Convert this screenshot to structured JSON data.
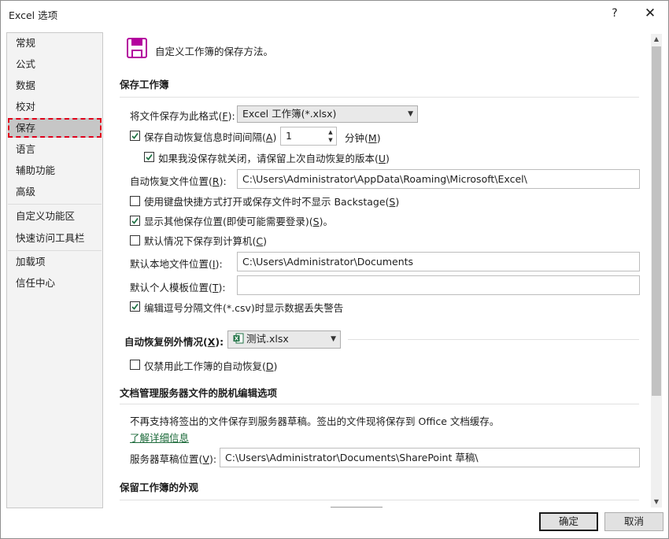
{
  "window": {
    "title": "Excel 选项",
    "help_label": "?",
    "close_label": "✕"
  },
  "nav": {
    "items": [
      "常规",
      "公式",
      "数据",
      "校对",
      "保存",
      "语言",
      "辅助功能",
      "高级",
      "自定义功能区",
      "快速访问工具栏",
      "加载项",
      "信任中心"
    ],
    "selected": "保存"
  },
  "header": {
    "icon": "save-floppy-icon",
    "text": "自定义工作簿的保存方法。"
  },
  "save_workbooks": {
    "title": "保存工作簿",
    "format_label_pre": "将文件保存为此格式(",
    "format_label_key": "F",
    "format_label_post": "):",
    "format_value": "Excel 工作簿(*.xlsx)",
    "autorecover_label_pre": "保存自动恢复信息时间间隔(",
    "autorecover_label_key": "A",
    "autorecover_label_post": ")",
    "autorecover_checked": true,
    "autorecover_minutes": "1",
    "minutes_label_pre": "分钟(",
    "minutes_label_key": "M",
    "minutes_label_post": ")",
    "keep_last_label_pre": "如果我没保存就关闭，请保留上次自动恢复的版本(",
    "keep_last_label_key": "U",
    "keep_last_label_post": ")",
    "keep_last_checked": true,
    "recover_location_label_pre": "自动恢复文件位置(",
    "recover_location_label_key": "R",
    "recover_location_label_post": "):",
    "recover_location_value": "C:\\Users\\Administrator\\AppData\\Roaming\\Microsoft\\Excel\\",
    "no_backstage_label_pre": "使用键盘快捷方式打开或保存文件时不显示 Backstage(",
    "no_backstage_label_key": "S",
    "no_backstage_label_post": ")",
    "no_backstage_checked": false,
    "show_additional_label_pre": "显示其他保存位置(即使可能需要登录)(",
    "show_additional_label_key": "S",
    "show_additional_label_post": ")。",
    "show_additional_checked": true,
    "save_to_computer_label_pre": "默认情况下保存到计算机(",
    "save_to_computer_label_key": "C",
    "save_to_computer_label_post": ")",
    "save_to_computer_checked": false,
    "default_local_label_pre": "默认本地文件位置(",
    "default_local_label_key": "I",
    "default_local_label_post": "):",
    "default_local_value": "C:\\Users\\Administrator\\Documents",
    "default_template_label_pre": "默认个人模板位置(",
    "default_template_label_key": "T",
    "default_template_label_post": "):",
    "default_template_value": "",
    "csv_warning_label": "编辑逗号分隔文件(*.csv)时显示数据丢失警告",
    "csv_warning_checked": true
  },
  "autorecover_exceptions": {
    "label_pre": "自动恢复例外情况(",
    "label_key": "X",
    "label_post": "):",
    "workbook_value": "测试.xlsx",
    "workbook_icon": "excel-file-icon",
    "disable_label_pre": "仅禁用此工作簿的自动恢复(",
    "disable_label_key": "D",
    "disable_label_post": ")",
    "disable_checked": false
  },
  "offline_editing": {
    "title": "文档管理服务器文件的脱机编辑选项",
    "notice": "不再支持将签出的文件保存到服务器草稿。签出的文件现将保存到 Office 文档缓存。",
    "learn_more": "了解详细信息",
    "drafts_label_pre": "服务器草稿位置(",
    "drafts_label_key": "V",
    "drafts_label_post": "):",
    "drafts_value": "C:\\Users\\Administrator\\Documents\\SharePoint 草稿\\"
  },
  "preserve_visual": {
    "title": "保留工作簿的外观"
  },
  "footer": {
    "ok": "确定",
    "cancel": "取消"
  },
  "colors": {
    "accent_green": "#217346",
    "selection_outline": "#e0001b",
    "save_icon_purple": "#b4009e"
  }
}
